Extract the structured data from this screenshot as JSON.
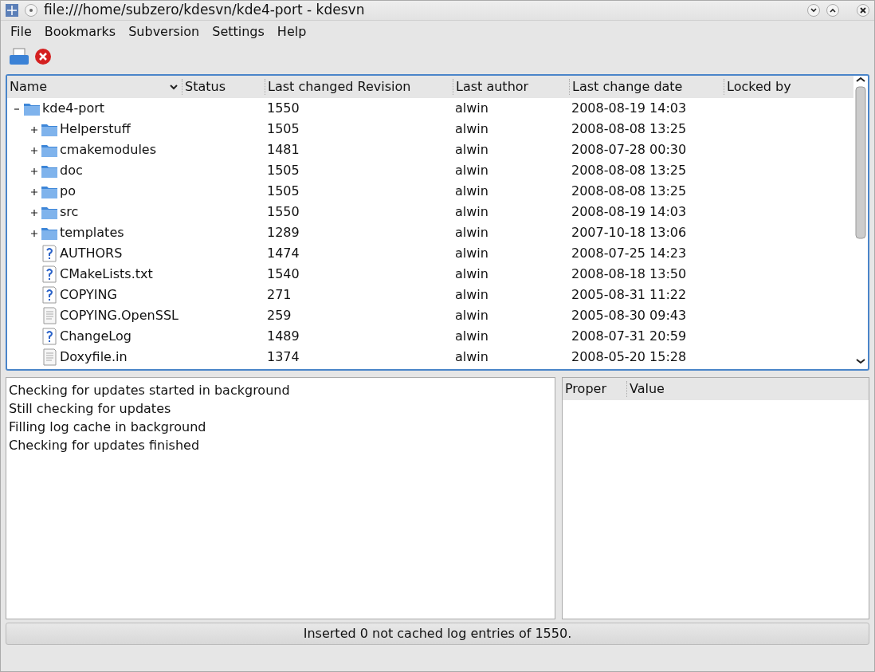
{
  "window": {
    "title": "file:///home/subzero/kdesvn/kde4-port - kdesvn"
  },
  "menu": [
    "File",
    "Bookmarks",
    "Subversion",
    "Settings",
    "Help"
  ],
  "tree": {
    "columns": [
      "Name",
      "Status",
      "Last changed Revision",
      "Last author",
      "Last change date",
      "Locked by"
    ],
    "items": [
      {
        "kind": "folder",
        "name": "kde4-port",
        "revision": "1550",
        "author": "alwin",
        "date": "2008-08-19 14:03",
        "expanded": true,
        "children": [
          {
            "kind": "folder",
            "name": "Helperstuff",
            "revision": "1505",
            "author": "alwin",
            "date": "2008-08-08 13:25",
            "expanded": false
          },
          {
            "kind": "folder",
            "name": "cmakemodules",
            "revision": "1481",
            "author": "alwin",
            "date": "2008-07-28 00:30",
            "expanded": false
          },
          {
            "kind": "folder",
            "name": "doc",
            "revision": "1505",
            "author": "alwin",
            "date": "2008-08-08 13:25",
            "expanded": false
          },
          {
            "kind": "folder",
            "name": "po",
            "revision": "1505",
            "author": "alwin",
            "date": "2008-08-08 13:25",
            "expanded": false
          },
          {
            "kind": "folder",
            "name": "src",
            "revision": "1550",
            "author": "alwin",
            "date": "2008-08-19 14:03",
            "expanded": false
          },
          {
            "kind": "folder",
            "name": "templates",
            "revision": "1289",
            "author": "alwin",
            "date": "2007-10-18 13:06",
            "expanded": false
          },
          {
            "kind": "unknown",
            "name": "AUTHORS",
            "revision": "1474",
            "author": "alwin",
            "date": "2008-07-25 14:23"
          },
          {
            "kind": "unknown",
            "name": "CMakeLists.txt",
            "revision": "1540",
            "author": "alwin",
            "date": "2008-08-18 13:50"
          },
          {
            "kind": "unknown",
            "name": "COPYING",
            "revision": "271",
            "author": "alwin",
            "date": "2005-08-31 11:22"
          },
          {
            "kind": "text",
            "name": "COPYING.OpenSSL",
            "revision": "259",
            "author": "alwin",
            "date": "2005-08-30 09:43"
          },
          {
            "kind": "unknown",
            "name": "ChangeLog",
            "revision": "1489",
            "author": "alwin",
            "date": "2008-07-31 20:59"
          },
          {
            "kind": "text",
            "name": "Doxyfile.in",
            "revision": "1374",
            "author": "alwin",
            "date": "2008-05-20 15:28"
          }
        ]
      }
    ]
  },
  "log": [
    "Checking for updates started in background",
    "Still checking for updates",
    "Filling log cache in background",
    "Checking for updates finished"
  ],
  "properties": {
    "columns": [
      "Proper",
      "Value"
    ]
  },
  "status_bar": "Inserted 0 not cached log entries of 1550."
}
